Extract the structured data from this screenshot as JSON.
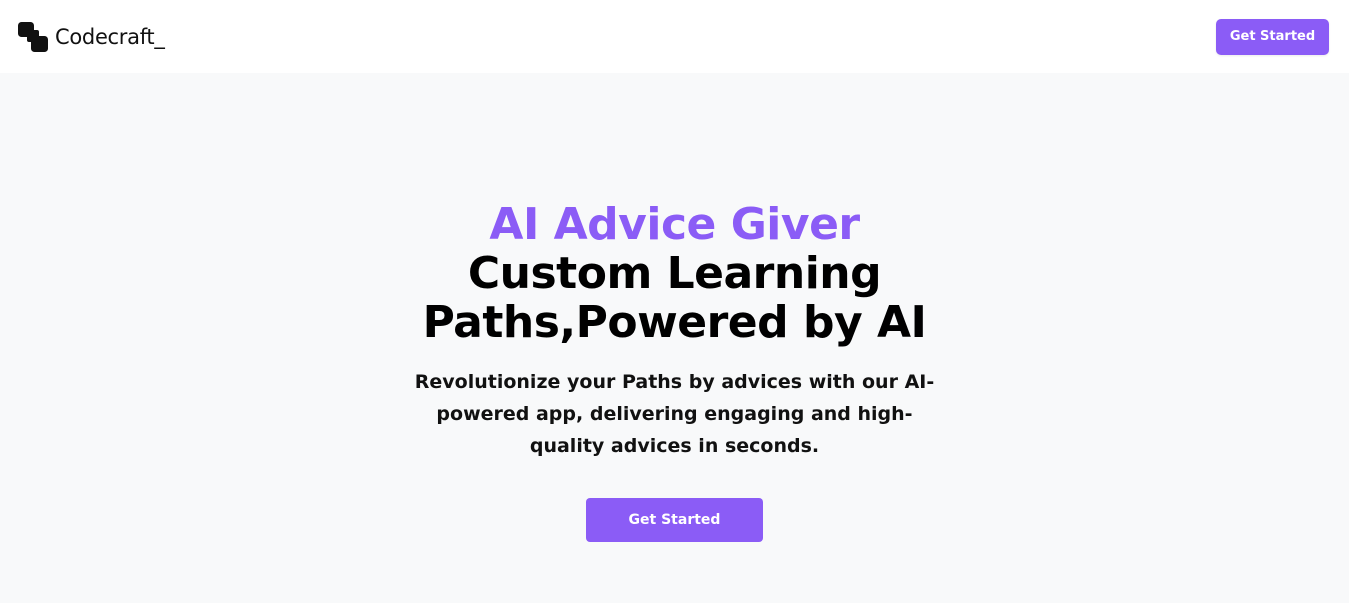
{
  "header": {
    "brand_name": "Codecraft_",
    "cta_label": "Get Started"
  },
  "hero": {
    "eyebrow": "AI Advice Giver",
    "title": "Custom Learning Paths,Powered by AI",
    "subtitle": "Revolutionize your Paths by advices with our AI-powered app, delivering engaging and high-quality advices in seconds.",
    "cta_label": "Get Started"
  },
  "colors": {
    "accent": "#8b5cf6",
    "page_background": "#f8f9fa",
    "header_background": "#ffffff",
    "text": "#000000"
  },
  "icons": {
    "logo": "codecraft-logo-icon"
  }
}
